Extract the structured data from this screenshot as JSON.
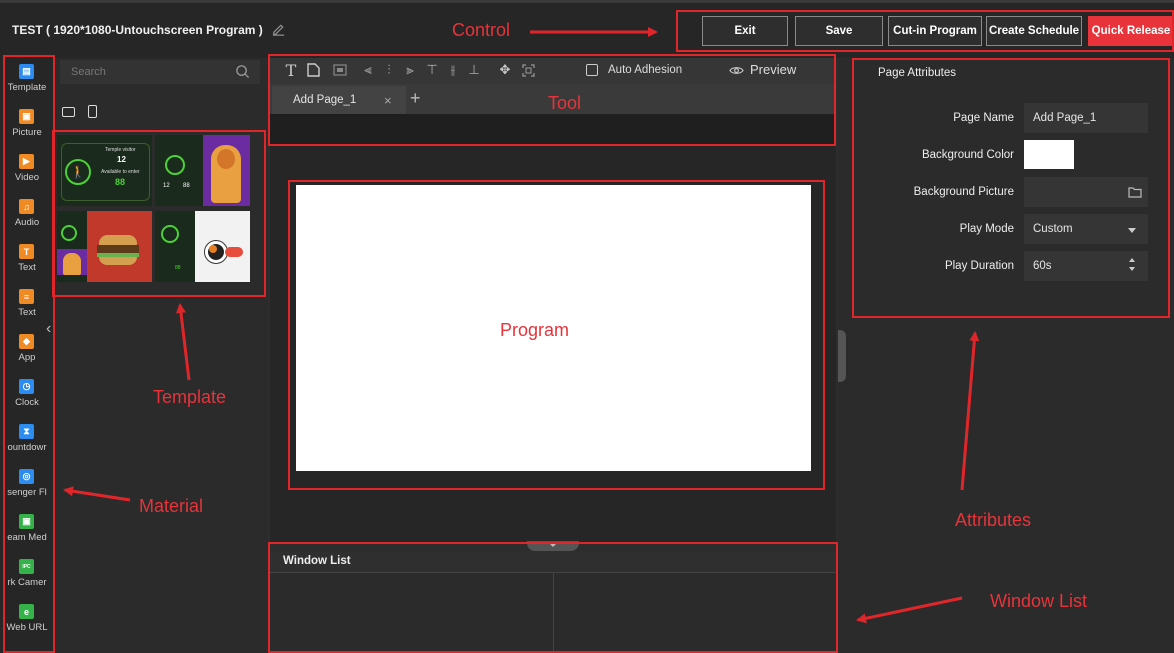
{
  "header": {
    "title": "TEST ( 1920*1080-Untouchscreen Program )",
    "buttons": [
      "Exit",
      "Save",
      "Cut-in Program",
      "Create Schedule",
      "Quick Release"
    ]
  },
  "materials": [
    {
      "label": "Template",
      "icon": "template-icon",
      "color": "#2d8cf0"
    },
    {
      "label": "Picture",
      "icon": "picture-icon",
      "color": "#f08a24"
    },
    {
      "label": "Video",
      "icon": "video-icon",
      "color": "#f08a24"
    },
    {
      "label": "Audio",
      "icon": "audio-icon",
      "color": "#f08a24"
    },
    {
      "label": "Text",
      "icon": "text-icon",
      "color": "#f08a24"
    },
    {
      "label": "Text",
      "icon": "document-icon",
      "color": "#f08a24"
    },
    {
      "label": "App",
      "icon": "app-icon",
      "color": "#f08a24"
    },
    {
      "label": "Clock",
      "icon": "clock-icon",
      "color": "#2d8cf0"
    },
    {
      "label": "ountdowr",
      "icon": "countdown-icon",
      "color": "#2d8cf0"
    },
    {
      "label": "senger Fl",
      "icon": "passenger-flow-icon",
      "color": "#2d8cf0"
    },
    {
      "label": "eam Med",
      "icon": "stream-media-icon",
      "color": "#35b34a"
    },
    {
      "label": "rk Camer",
      "icon": "network-camera-icon",
      "color": "#35b34a"
    },
    {
      "label": "Web URL",
      "icon": "web-url-icon",
      "color": "#35b34a"
    }
  ],
  "template_panel": {
    "search_placeholder": "Search",
    "thumb_texts": [
      "Temple visitor",
      "12",
      "Available to enter",
      "88",
      "12",
      "88"
    ]
  },
  "toolbar": {
    "auto_adhesion": "Auto Adhesion",
    "preview": "Preview"
  },
  "tabs": [
    {
      "label": "Add Page_1"
    }
  ],
  "window_list": {
    "title": "Window List"
  },
  "attributes": {
    "title": "Page Attributes",
    "rows": [
      {
        "label": "Page Name",
        "value": "Add Page_1"
      },
      {
        "label": "Background Color",
        "value": ""
      },
      {
        "label": "Background Picture",
        "value": ""
      },
      {
        "label": "Play Mode",
        "value": "Custom"
      },
      {
        "label": "Play Duration",
        "value": "60s"
      }
    ]
  },
  "annotations": {
    "control": "Control",
    "tool": "Tool",
    "program": "Program",
    "template": "Template",
    "material": "Material",
    "attributes": "Attributes",
    "window_list": "Window List"
  },
  "colors": {
    "accent": "#e8333a",
    "annotation": "#e1262b"
  }
}
